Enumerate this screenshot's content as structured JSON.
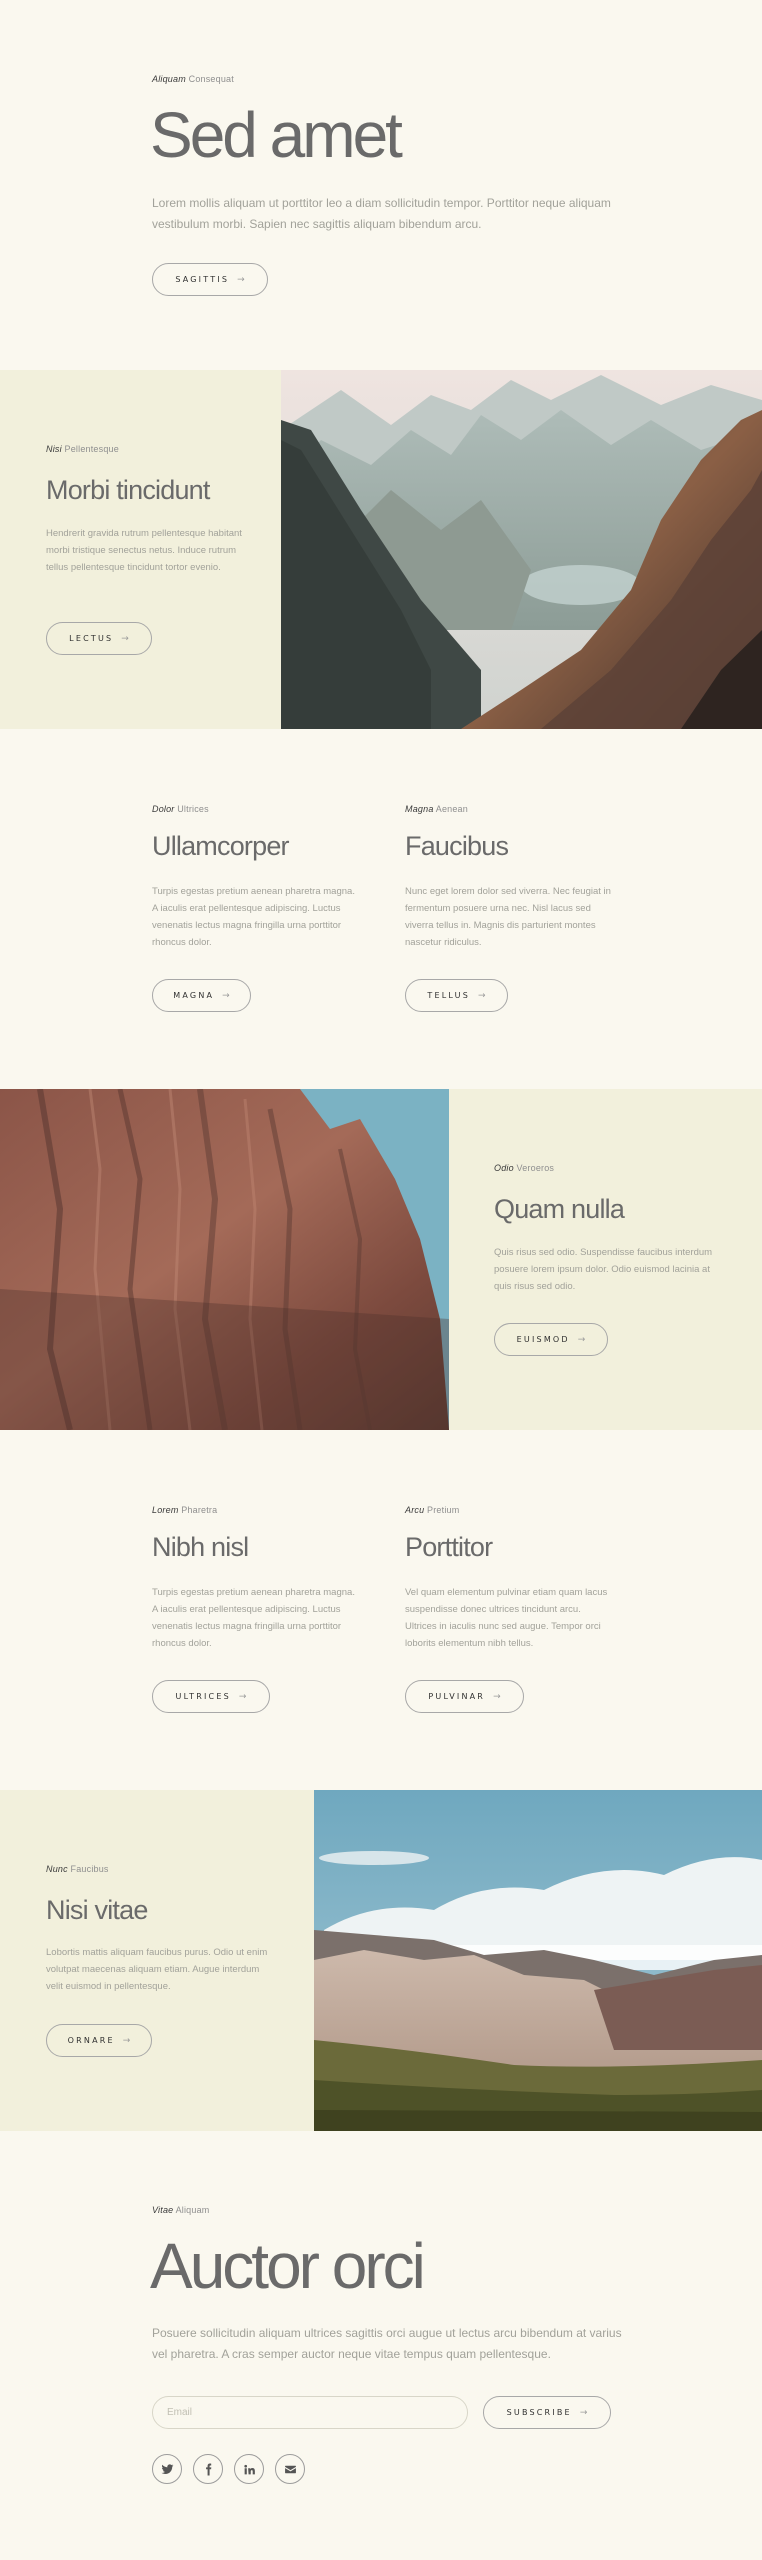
{
  "hero": {
    "eyebrow_em": "Aliquam",
    "eyebrow_rest": " Consequat",
    "title": "Sed amet",
    "text": "Lorem mollis aliquam ut porttitor leo a diam sollicitudin tempor. Porttitor neque aliquam vestibulum morbi. Sapien nec sagittis aliquam bibendum arcu.",
    "button": "SAGITTIS"
  },
  "section1": {
    "eyebrow_em": "Nisi",
    "eyebrow_rest": " Pellentesque",
    "title": "Morbi tincidunt",
    "text": "Hendrerit gravida rutrum pellentesque habitant morbi tristique senectus netus. Induce rutrum tellus pellentesque tincidunt tortor evenio.",
    "button": "LECTUS"
  },
  "columns1": [
    {
      "eyebrow_em": "Dolor",
      "eyebrow_rest": " Ultrices",
      "title": "Ullamcorper",
      "text": "Turpis egestas pretium aenean pharetra magna. A iaculis erat pellentesque adipiscing. Luctus venenatis lectus magna fringilla urna porttitor rhoncus dolor.",
      "button": "MAGNA"
    },
    {
      "eyebrow_em": "Magna",
      "eyebrow_rest": " Aenean",
      "title": "Faucibus",
      "text": "Nunc eget lorem dolor sed viverra. Nec feugiat in fermentum posuere urna nec. Nisl lacus sed viverra tellus in. Magnis dis parturient montes nascetur ridiculus.",
      "button": "TELLUS"
    }
  ],
  "section2": {
    "eyebrow_em": "Odio",
    "eyebrow_rest": " Veroeros",
    "title": "Quam nulla",
    "text": "Quis risus sed odio. Suspendisse faucibus interdum posuere lorem ipsum dolor. Odio euismod lacinia at quis risus sed odio.",
    "button": "EUISMOD"
  },
  "columns2": [
    {
      "eyebrow_em": "Lorem",
      "eyebrow_rest": " Pharetra",
      "title": "Nibh nisl",
      "text": "Turpis egestas pretium aenean pharetra magna. A iaculis erat pellentesque adipiscing. Luctus venenatis lectus magna fringilla urna porttitor rhoncus dolor.",
      "button": "ULTRICES"
    },
    {
      "eyebrow_em": "Arcu",
      "eyebrow_rest": " Pretium",
      "title": "Porttitor",
      "text": "Vel quam elementum pulvinar etiam quam lacus suspendisse donec ultrices tincidunt arcu. Ultrices in iaculis nunc sed augue. Tempor orci loborits elementum nibh tellus.",
      "button": "PULVINAR"
    }
  ],
  "section3": {
    "eyebrow_em": "Nunc",
    "eyebrow_rest": " Faucibus",
    "title": "Nisi vitae",
    "text": "Lobortis mattis aliquam faucibus purus. Odio ut enim volutpat maecenas aliquam etiam. Augue interdum velit euismod in pellentesque.",
    "button": "ORNARE"
  },
  "footer": {
    "eyebrow_em": "Vitae",
    "eyebrow_rest": " Aliquam",
    "title": "Auctor orci",
    "text": "Posuere sollicitudin aliquam ultrices sagittis orci augue ut lectus arcu bibendum at varius vel pharetra. A cras semper auctor neque vitae tempus quam pellentesque.",
    "email_placeholder": "Email",
    "button": "SUBSCRIBE",
    "social": [
      "twitter-icon",
      "facebook-icon",
      "linkedin-icon",
      "email-icon"
    ]
  },
  "arrow": "→"
}
